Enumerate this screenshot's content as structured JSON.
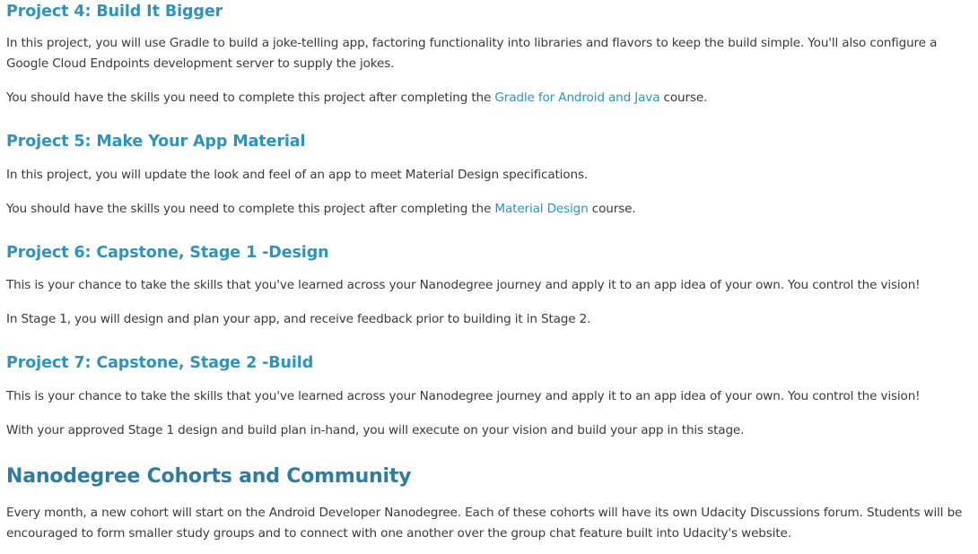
{
  "sections": [
    {
      "title": "Project 4: Build It Bigger",
      "paragraph1": "In this project, you will use Gradle to build a joke-telling app, factoring functionality into libraries and flavors to keep the build simple. You'll also configure a Google Cloud Endpoints development server to supply the jokes.",
      "skills_prefix": "You should have the skills you need to complete this project after completing the ",
      "skills_link": "Gradle for Android and Java",
      "skills_suffix": " course."
    },
    {
      "title": "Project 5: Make Your App Material",
      "paragraph1": "In this project, you will update the look and feel of an app to meet Material Design specifications.",
      "skills_prefix": "You should have the skills you need to complete this project after completing the ",
      "skills_link": "Material Design",
      "skills_suffix": " course."
    },
    {
      "title": "Project 6: Capstone, Stage 1 -Design",
      "paragraph1": "This is your chance to take the skills that you've learned across your Nanodegree journey and apply it to an app idea of your own. You control the vision!",
      "paragraph2": "In Stage 1, you will design and plan your app, and receive feedback prior to building it in Stage 2."
    },
    {
      "title": "Project 7: Capstone, Stage 2 -Build",
      "paragraph1": "This is your chance to take the skills that you've learned across your Nanodegree journey and apply it to an app idea of your own. You control the vision!",
      "paragraph2": "With your approved Stage 1 design and build plan in-hand, you will execute on your vision and build your app in this stage."
    }
  ],
  "community": {
    "title": "Nanodegree Cohorts and Community",
    "paragraph": "Every month, a new cohort will start on the Android Developer Nanodegree. Each of these cohorts will have its own Udacity Discussions forum. Students will be encouraged to form smaller study groups and to connect with one another over the group chat feature built into Udacity's website."
  },
  "colors": {
    "heading": "#2e93c0",
    "section_heading": "#2e7ca3",
    "link": "#2e93c0",
    "body_text": "#3a3a3a"
  }
}
